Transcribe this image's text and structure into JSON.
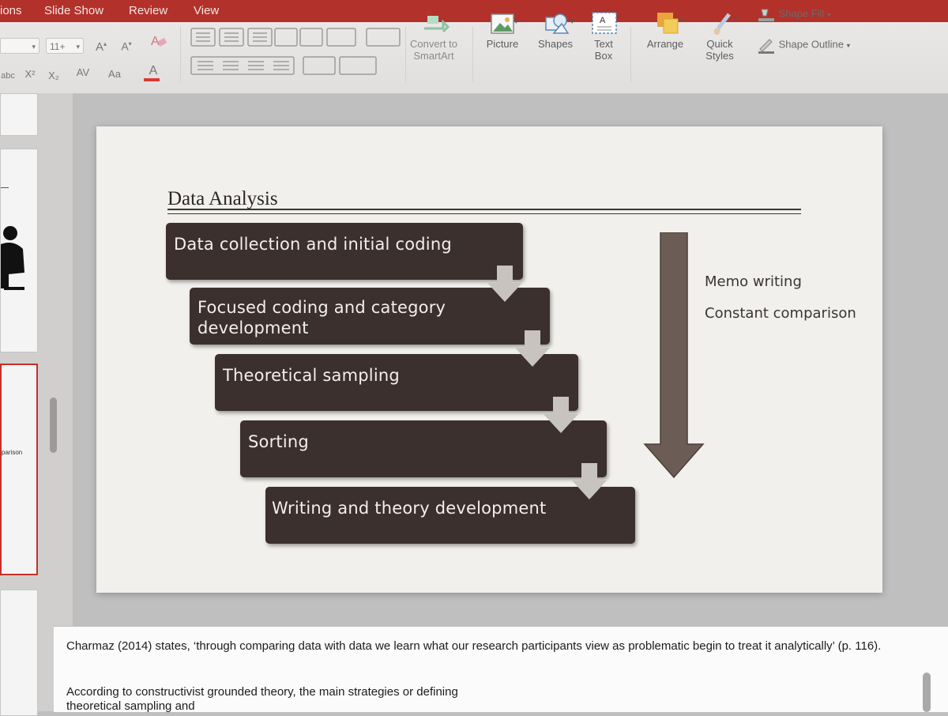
{
  "ribbon": {
    "tabs": [
      "ions",
      "Slide Show",
      "Review",
      "View"
    ],
    "font_size": "11+",
    "font_grow": "A",
    "font_shrink": "A",
    "superscript": "X²",
    "subscript": "X₂",
    "char_spacing": "AV",
    "change_case": "Aa",
    "font_color": "A",
    "strikethrough": "abc",
    "convert_smartart": [
      "Convert to",
      "SmartArt"
    ],
    "picture": "Picture",
    "shapes": "Shapes",
    "textbox": [
      "Text",
      "Box"
    ],
    "arrange": "Arrange",
    "quick_styles": [
      "Quick",
      "Styles"
    ],
    "shape_fill": "Shape Fill",
    "shape_outline": "Shape Outline"
  },
  "thumbnails": {
    "partial_label": "parison"
  },
  "slide": {
    "title": "Data Analysis",
    "steps": [
      "Data collection and initial coding",
      "Focused coding and category development",
      "Theoretical sampling",
      "Sorting",
      "Writing and theory development"
    ],
    "side_labels": [
      "Memo writing",
      "Constant comparison"
    ]
  },
  "notes": {
    "para1": "Charmaz (2014) states, ‘through comparing data with data we learn what our research participants view as problematic begin to treat it analytically’ (p. 116).",
    "para2": "According to constructivist grounded theory, the main strategies or defining",
    "para3": "theoretical sampling and"
  },
  "colors": {
    "tab_bar": "#b2312a",
    "step_fill": "#3b302d",
    "side_arrow": "#6b5d55",
    "step_arrow": "#c7c3bf"
  }
}
